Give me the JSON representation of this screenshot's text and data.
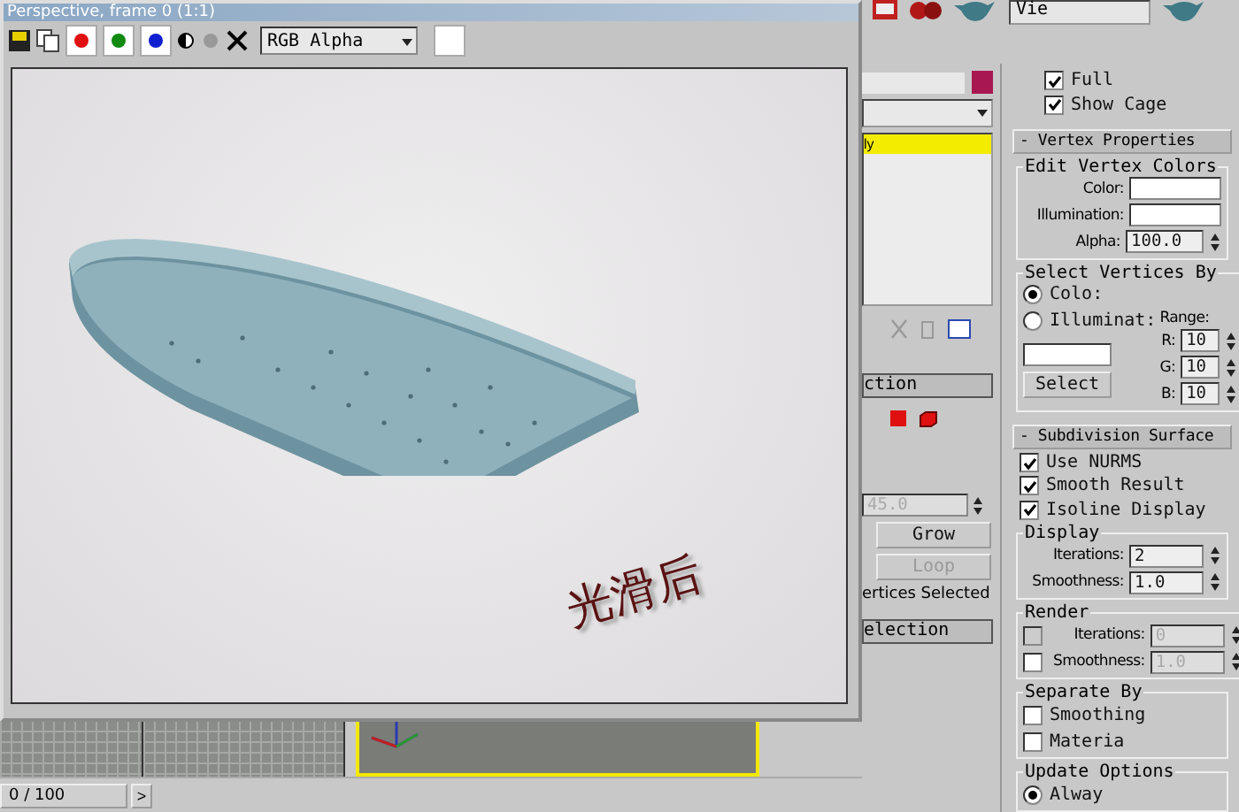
{
  "top_toolbar": {
    "view_field": "Vie"
  },
  "render_window": {
    "title": "Perspective, frame 0 (1:1)",
    "channel_select": "RGB Alpha",
    "caption": "光滑后"
  },
  "modify_panel": {
    "list_item": "ly",
    "rollout_title": "ction",
    "angle": "45.0",
    "buttons": [
      {
        "label": "Grow",
        "disabled": false
      },
      {
        "label": "Loop",
        "disabled": true
      }
    ],
    "status": "ertices Selected",
    "rollout_title_2": "election"
  },
  "command_panel": {
    "options": [
      {
        "label": "Full",
        "checked": true
      },
      {
        "label": "Show Cage",
        "checked": true
      }
    ],
    "vertex_properties": {
      "title": "- Vertex Properties",
      "group": "Edit Vertex Colors",
      "color_label": "Color:",
      "illumination_label": "Illumination:",
      "alpha_label": "Alpha:",
      "alpha": "100.0",
      "select_group": "Select Vertices By",
      "modes": [
        {
          "label": "Colo:",
          "selected": true
        },
        {
          "label": "Illuminat:",
          "selected": false
        }
      ],
      "range_label": "Range:",
      "ranges": [
        {
          "label": "R:",
          "value": "10"
        },
        {
          "label": "G:",
          "value": "10"
        },
        {
          "label": "B:",
          "value": "10"
        }
      ],
      "select_button": "Select"
    },
    "subdivision": {
      "title": "- Subdivision Surface",
      "checks": [
        {
          "label": "Use NURMS",
          "checked": true
        },
        {
          "label": "Smooth Result",
          "checked": true
        },
        {
          "label": "Isoline Display",
          "checked": true
        }
      ],
      "display": {
        "legend": "Display",
        "iterations_label": "Iterations:",
        "iterations": "2",
        "smoothness_label": "Smoothness:",
        "smoothness": "1.0"
      },
      "render": {
        "legend": "Render",
        "iterations_checked": false,
        "iterations_label": "Iterations:",
        "iterations": "0",
        "smoothness_checked": false,
        "smoothness_label": "Smoothness:",
        "smoothness": "1.0"
      },
      "separate_by": {
        "legend": "Separate By",
        "checks": [
          {
            "label": "Smoothing",
            "checked": false
          },
          {
            "label": "Materia",
            "checked": false
          }
        ]
      },
      "update_options": {
        "legend": "Update Options",
        "radio_label": "Alway",
        "selected": true
      }
    }
  },
  "timeline": {
    "frame": "0 / 100",
    "next": ">"
  }
}
